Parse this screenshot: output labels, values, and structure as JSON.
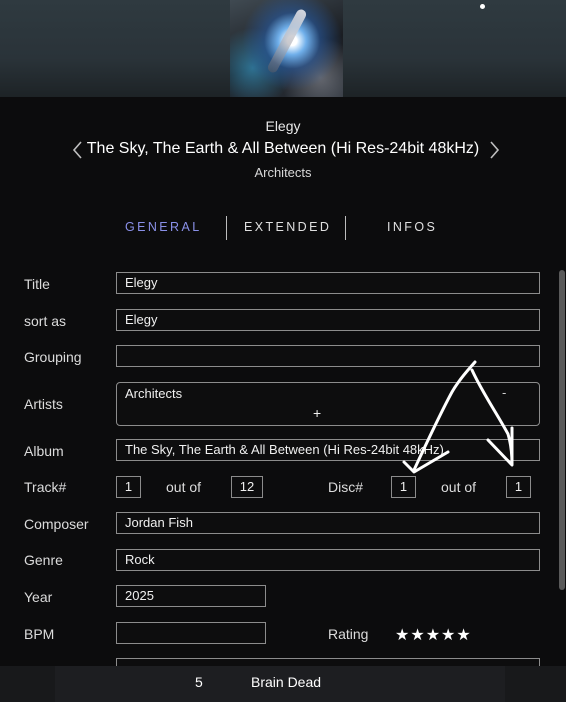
{
  "header": {
    "track_name": "Elegy",
    "album_title": "The Sky, The Earth & All Between (Hi Res-24bit 48kHz)",
    "artist": "Architects"
  },
  "tabs": [
    {
      "label": "GENERAL",
      "active": true
    },
    {
      "label": "EXTENDED",
      "active": false
    },
    {
      "label": "INFOS",
      "active": false
    }
  ],
  "form": {
    "title_label": "Title",
    "title_value": "Elegy",
    "sortas_label": "sort as",
    "sortas_value": "Elegy",
    "grouping_label": "Grouping",
    "grouping_value": "",
    "artists_label": "Artists",
    "artists_value": "Architects",
    "artists_remove": "-",
    "artists_add": "+",
    "album_label": "Album",
    "album_value": "The Sky, The Earth & All Between (Hi Res-24bit 48kHz)",
    "track_label": "Track#",
    "track_value": "1",
    "track_outof": "out of",
    "track_total": "12",
    "disc_label": "Disc#",
    "disc_value": "1",
    "disc_outof": "out of",
    "disc_total": "1",
    "composer_label": "Composer",
    "composer_value": "Jordan Fish",
    "genre_label": "Genre",
    "genre_value": "Rock",
    "year_label": "Year",
    "year_value": "2025",
    "bpm_label": "BPM",
    "bpm_value": "",
    "rating_label": "Rating",
    "rating_stars": "★★★★★",
    "rating_value": 5
  },
  "now_playing": {
    "number": "5",
    "title": "Brain Dead"
  },
  "colors": {
    "accent_tab": "#8a90e8",
    "background": "#0c0c0d",
    "field_border": "#8c8c8c"
  },
  "icons": [
    "chevron-left-icon",
    "chevron-right-icon",
    "star-icon"
  ]
}
